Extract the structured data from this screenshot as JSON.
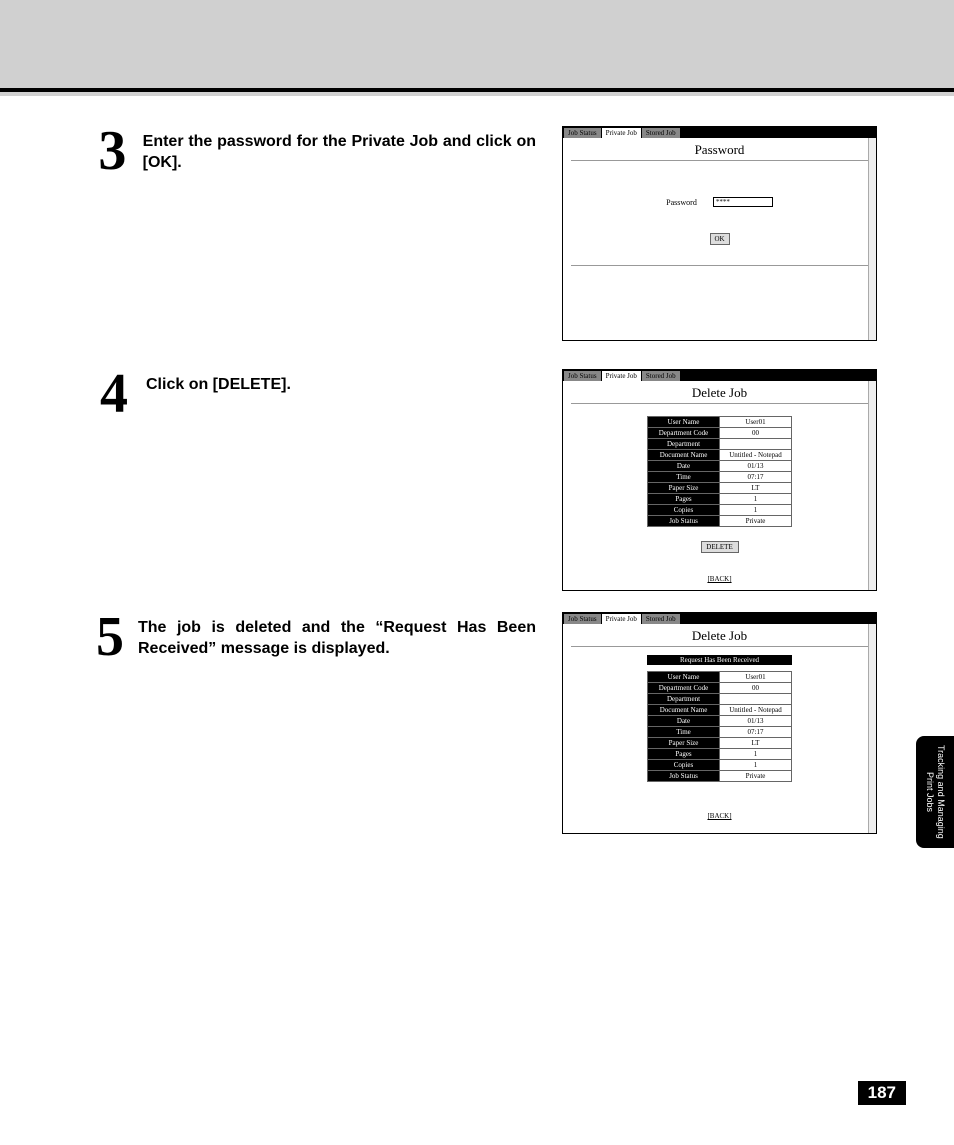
{
  "steps": {
    "s3_num": "3",
    "s3_text": "Enter the password for the Private Job and click on [OK].",
    "s4_num": "4",
    "s4_text": "Click on [DELETE].",
    "s5_num": "5",
    "s5_text": "The job is deleted and the “Request Has Been Received” message is displayed."
  },
  "tabs": {
    "t1": "Job Status",
    "t2": "Private Job",
    "t3": "Stored Job"
  },
  "shot3": {
    "title": "Password",
    "pw_label": "Password",
    "pw_value": "****",
    "ok": "OK"
  },
  "shot4": {
    "title": "Delete Job",
    "rows": [
      {
        "k": "User Name",
        "v": "User01"
      },
      {
        "k": "Department Code",
        "v": "00"
      },
      {
        "k": "Department",
        "v": ""
      },
      {
        "k": "Document Name",
        "v": "Untitled - Notepad"
      },
      {
        "k": "Date",
        "v": "01/13"
      },
      {
        "k": "Time",
        "v": "07:17"
      },
      {
        "k": "Paper Size",
        "v": "LT"
      },
      {
        "k": "Pages",
        "v": "1"
      },
      {
        "k": "Copies",
        "v": "1"
      },
      {
        "k": "Job Status",
        "v": "Private"
      }
    ],
    "delete": "DELETE",
    "back": "[BACK]"
  },
  "shot5": {
    "title": "Delete Job",
    "banner": "Request Has Been Received",
    "rows": [
      {
        "k": "User Name",
        "v": "User01"
      },
      {
        "k": "Department Code",
        "v": "00"
      },
      {
        "k": "Department",
        "v": ""
      },
      {
        "k": "Document Name",
        "v": "Untitled - Notepad"
      },
      {
        "k": "Date",
        "v": "01/13"
      },
      {
        "k": "Time",
        "v": "07:17"
      },
      {
        "k": "Paper Size",
        "v": "LT"
      },
      {
        "k": "Pages",
        "v": "1"
      },
      {
        "k": "Copies",
        "v": "1"
      },
      {
        "k": "Job Status",
        "v": "Private"
      }
    ],
    "back": "[BACK]"
  },
  "side_tab": "Tracking and\nManaging Print Jobs",
  "page_number": "187"
}
